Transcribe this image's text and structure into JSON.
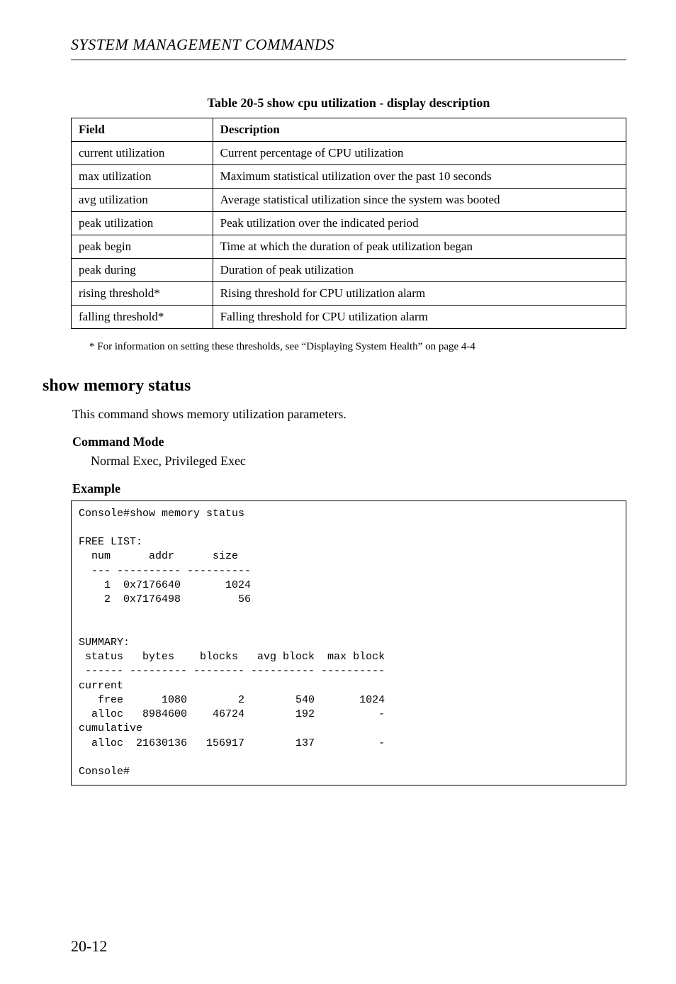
{
  "chapter_header": "SYSTEM MANAGEMENT COMMANDS",
  "table": {
    "caption": "Table 20-5  show cpu utilization - display description",
    "header_field": "Field",
    "header_description": "Description",
    "rows": [
      {
        "field": "current utilization",
        "desc": "Current percentage of CPU utilization"
      },
      {
        "field": "max utilization",
        "desc": "Maximum statistical utilization over the past 10 seconds"
      },
      {
        "field": "avg utilization",
        "desc": "Average statistical utilization since the system was booted"
      },
      {
        "field": "peak utilization",
        "desc": "Peak utilization over the indicated period"
      },
      {
        "field": "peak begin",
        "desc": "Time at which the duration of peak utilization began"
      },
      {
        "field": "peak during",
        "desc": "Duration of peak utilization"
      },
      {
        "field": "rising threshold*",
        "desc": "Rising threshold for CPU utilization alarm"
      },
      {
        "field": "falling threshold*",
        "desc": "Falling threshold for CPU utilization alarm"
      }
    ]
  },
  "footnote": "* For information on setting these thresholds, see “Displaying System Health” on page 4-4",
  "section": {
    "title": "show memory status",
    "desc": "This command shows memory utilization parameters.",
    "command_mode_h": "Command Mode",
    "command_mode_body": "Normal Exec, Privileged Exec",
    "example_h": "Example",
    "code": "Console#show memory status\n\nFREE LIST:\n  num      addr      size\n  --- ---------- ----------\n    1  0x7176640       1024\n    2  0x7176498         56\n\n\nSUMMARY:\n status   bytes    blocks   avg block  max block\n ------ --------- -------- ---------- ----------\ncurrent\n   free      1080        2        540       1024\n  alloc   8984600    46724        192          -\ncumulative\n  alloc  21630136   156917        137          -\n\nConsole#"
  },
  "page_number": "20-12"
}
